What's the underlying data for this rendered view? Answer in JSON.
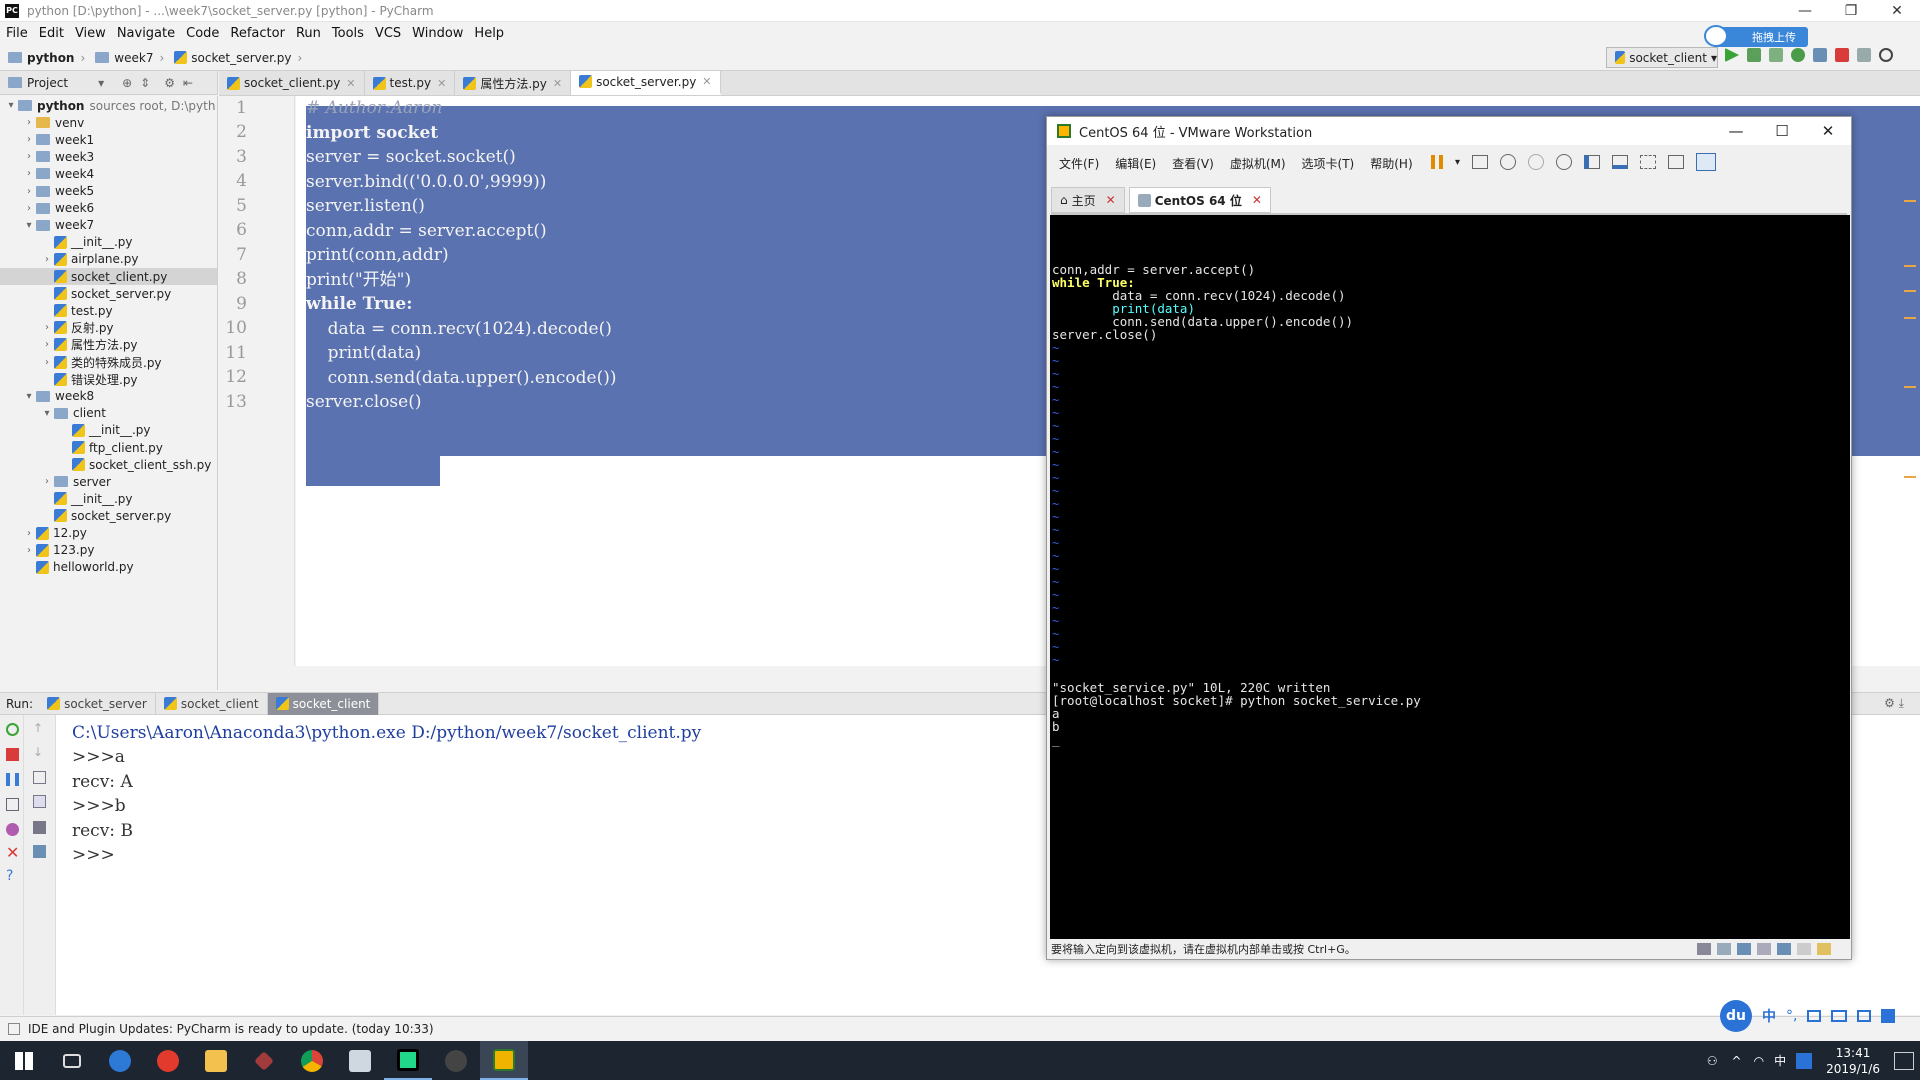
{
  "window": {
    "title": "python [D:\\python] - ...\\week7\\socket_server.py [python] - PyCharm"
  },
  "menu": [
    "File",
    "Edit",
    "View",
    "Navigate",
    "Code",
    "Refactor",
    "Run",
    "Tools",
    "VCS",
    "Window",
    "Help"
  ],
  "breadcrumb": [
    "python",
    "week7",
    "socket_server.py"
  ],
  "run_config": "socket_client",
  "baidu_upload": "拖拽上传",
  "project_panel": {
    "label": "Project"
  },
  "file_tabs": [
    {
      "label": "socket_client.py"
    },
    {
      "label": "test.py"
    },
    {
      "label": "属性方法.py"
    },
    {
      "label": "socket_server.py"
    }
  ],
  "tree": [
    {
      "label": "python",
      "extra": "sources root, D:\\pyth",
      "indent": 0,
      "arrow": "▾",
      "type": "folder",
      "bold": true
    },
    {
      "label": "venv",
      "indent": 1,
      "arrow": "›",
      "type": "folder-y"
    },
    {
      "label": "week1",
      "indent": 1,
      "arrow": "›",
      "type": "folder"
    },
    {
      "label": "week3",
      "indent": 1,
      "arrow": "›",
      "type": "folder"
    },
    {
      "label": "week4",
      "indent": 1,
      "arrow": "›",
      "type": "folder"
    },
    {
      "label": "week5",
      "indent": 1,
      "arrow": "›",
      "type": "folder"
    },
    {
      "label": "week6",
      "indent": 1,
      "arrow": "›",
      "type": "folder"
    },
    {
      "label": "week7",
      "indent": 1,
      "arrow": "▾",
      "type": "folder"
    },
    {
      "label": "__init__.py",
      "indent": 2,
      "arrow": "",
      "type": "py"
    },
    {
      "label": "airplane.py",
      "indent": 2,
      "arrow": "›",
      "type": "py"
    },
    {
      "label": "socket_client.py",
      "indent": 2,
      "arrow": "",
      "type": "py",
      "selected": true
    },
    {
      "label": "socket_server.py",
      "indent": 2,
      "arrow": "",
      "type": "py"
    },
    {
      "label": "test.py",
      "indent": 2,
      "arrow": "",
      "type": "py"
    },
    {
      "label": "反射.py",
      "indent": 2,
      "arrow": "›",
      "type": "py"
    },
    {
      "label": "属性方法.py",
      "indent": 2,
      "arrow": "›",
      "type": "py"
    },
    {
      "label": "类的特殊成员.py",
      "indent": 2,
      "arrow": "›",
      "type": "py"
    },
    {
      "label": "错误处理.py",
      "indent": 2,
      "arrow": "",
      "type": "py"
    },
    {
      "label": "week8",
      "indent": 1,
      "arrow": "▾",
      "type": "folder"
    },
    {
      "label": "client",
      "indent": 2,
      "arrow": "▾",
      "type": "folder"
    },
    {
      "label": "__init__.py",
      "indent": 3,
      "arrow": "",
      "type": "py"
    },
    {
      "label": "ftp_client.py",
      "indent": 3,
      "arrow": "",
      "type": "py"
    },
    {
      "label": "socket_client_ssh.py",
      "indent": 3,
      "arrow": "",
      "type": "py"
    },
    {
      "label": "server",
      "indent": 2,
      "arrow": "›",
      "type": "folder"
    },
    {
      "label": "__init__.py",
      "indent": 2,
      "arrow": "",
      "type": "py"
    },
    {
      "label": "socket_server.py",
      "indent": 2,
      "arrow": "",
      "type": "py"
    },
    {
      "label": "12.py",
      "indent": 1,
      "arrow": "›",
      "type": "py"
    },
    {
      "label": "123.py",
      "indent": 1,
      "arrow": "›",
      "type": "py"
    },
    {
      "label": "helloworld.py",
      "indent": 1,
      "arrow": "",
      "type": "py"
    }
  ],
  "editor": {
    "line_numbers": [
      "1",
      "2",
      "3",
      "4",
      "5",
      "6",
      "7",
      "8",
      "9",
      "10",
      "11",
      "12",
      "13"
    ],
    "lines": [
      "# Author:Aaron",
      "import socket",
      "server = socket.socket()",
      "server.bind(('0.0.0.0',9999))",
      "server.listen()",
      "conn,addr = server.accept()",
      "print(conn,addr)",
      "print(\"开始\")",
      "while True:",
      "    data = conn.recv(1024).decode()",
      "    print(data)",
      "    conn.send(data.upper().encode())",
      "server.close()"
    ]
  },
  "run_panel": {
    "label": "Run:",
    "tabs": [
      "socket_server",
      "socket_client",
      "socket_client"
    ],
    "console": [
      "C:\\Users\\Aaron\\Anaconda3\\python.exe D:/python/week7/socket_client.py",
      ">>>a",
      "recv: A",
      ">>>b",
      "recv: B",
      ">>>"
    ]
  },
  "status": "IDE and Plugin Updates: PyCharm is ready to update. (today 10:33)",
  "vm": {
    "title": "CentOS 64 位 - VMware Workstation",
    "menu": [
      "文件(F)",
      "编辑(E)",
      "查看(V)",
      "虚拟机(M)",
      "选项卡(T)",
      "帮助(H)"
    ],
    "tabs": [
      "主页",
      "CentOS 64 位"
    ],
    "terminal": {
      "code": [
        "conn,addr = server.accept()",
        "while True:",
        "        data = conn.recv(1024).decode()",
        "        print(data)",
        "        conn.send(data.upper().encode())",
        "server.close()"
      ],
      "output": [
        "\"socket_service.py\" 10L, 220C written",
        "[root@localhost socket]# python socket_service.py",
        "a",
        "b",
        "_"
      ]
    },
    "status": "要将输入定向到该虚拟机，请在虚拟机内部单击或按 Ctrl+G。"
  },
  "taskbar": {
    "time": "13:41",
    "date": "2019/1/6",
    "ime": "中"
  },
  "ime_bar": {
    "logo": "du",
    "lang": "中"
  }
}
